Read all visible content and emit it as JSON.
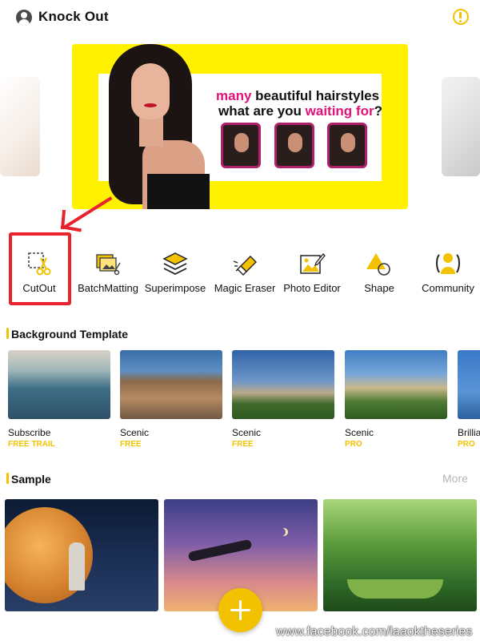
{
  "header": {
    "title": "Knock Out",
    "avatar_icon": "user-avatar-icon",
    "alert_icon": "warning-circle-icon",
    "accent_color": "#f2c200"
  },
  "banner": {
    "line1_highlight": "many",
    "line1_rest": " beautiful hairstyles",
    "line2_start": "what are you ",
    "line2_highlight": "waiting for",
    "line2_end": "?",
    "background_color": "#fff100",
    "highlight_color": "#e0117a"
  },
  "tools": [
    {
      "label": "CutOut",
      "icon": "cutout-scissors-icon"
    },
    {
      "label": "BatchMatting",
      "icon": "batch-matting-icon"
    },
    {
      "label": "Superimpose",
      "icon": "layers-icon"
    },
    {
      "label": "Magic Eraser",
      "icon": "eraser-icon"
    },
    {
      "label": "Photo Editor",
      "icon": "photo-edit-icon"
    },
    {
      "label": "Shape",
      "icon": "shape-icon"
    },
    {
      "label": "Community",
      "icon": "community-icon"
    }
  ],
  "background_template": {
    "title": "Background Template",
    "items": [
      {
        "name": "Subscribe",
        "tag": "FREE TRAIL"
      },
      {
        "name": "Scenic",
        "tag": "FREE"
      },
      {
        "name": "Scenic",
        "tag": "FREE"
      },
      {
        "name": "Scenic",
        "tag": "PRO"
      },
      {
        "name": "Brillia",
        "tag": "PRO"
      }
    ]
  },
  "sample": {
    "title": "Sample",
    "more_label": "More"
  },
  "fab_icon": "plus-icon",
  "watermark": "www.facebook.com/laaoktheseries"
}
